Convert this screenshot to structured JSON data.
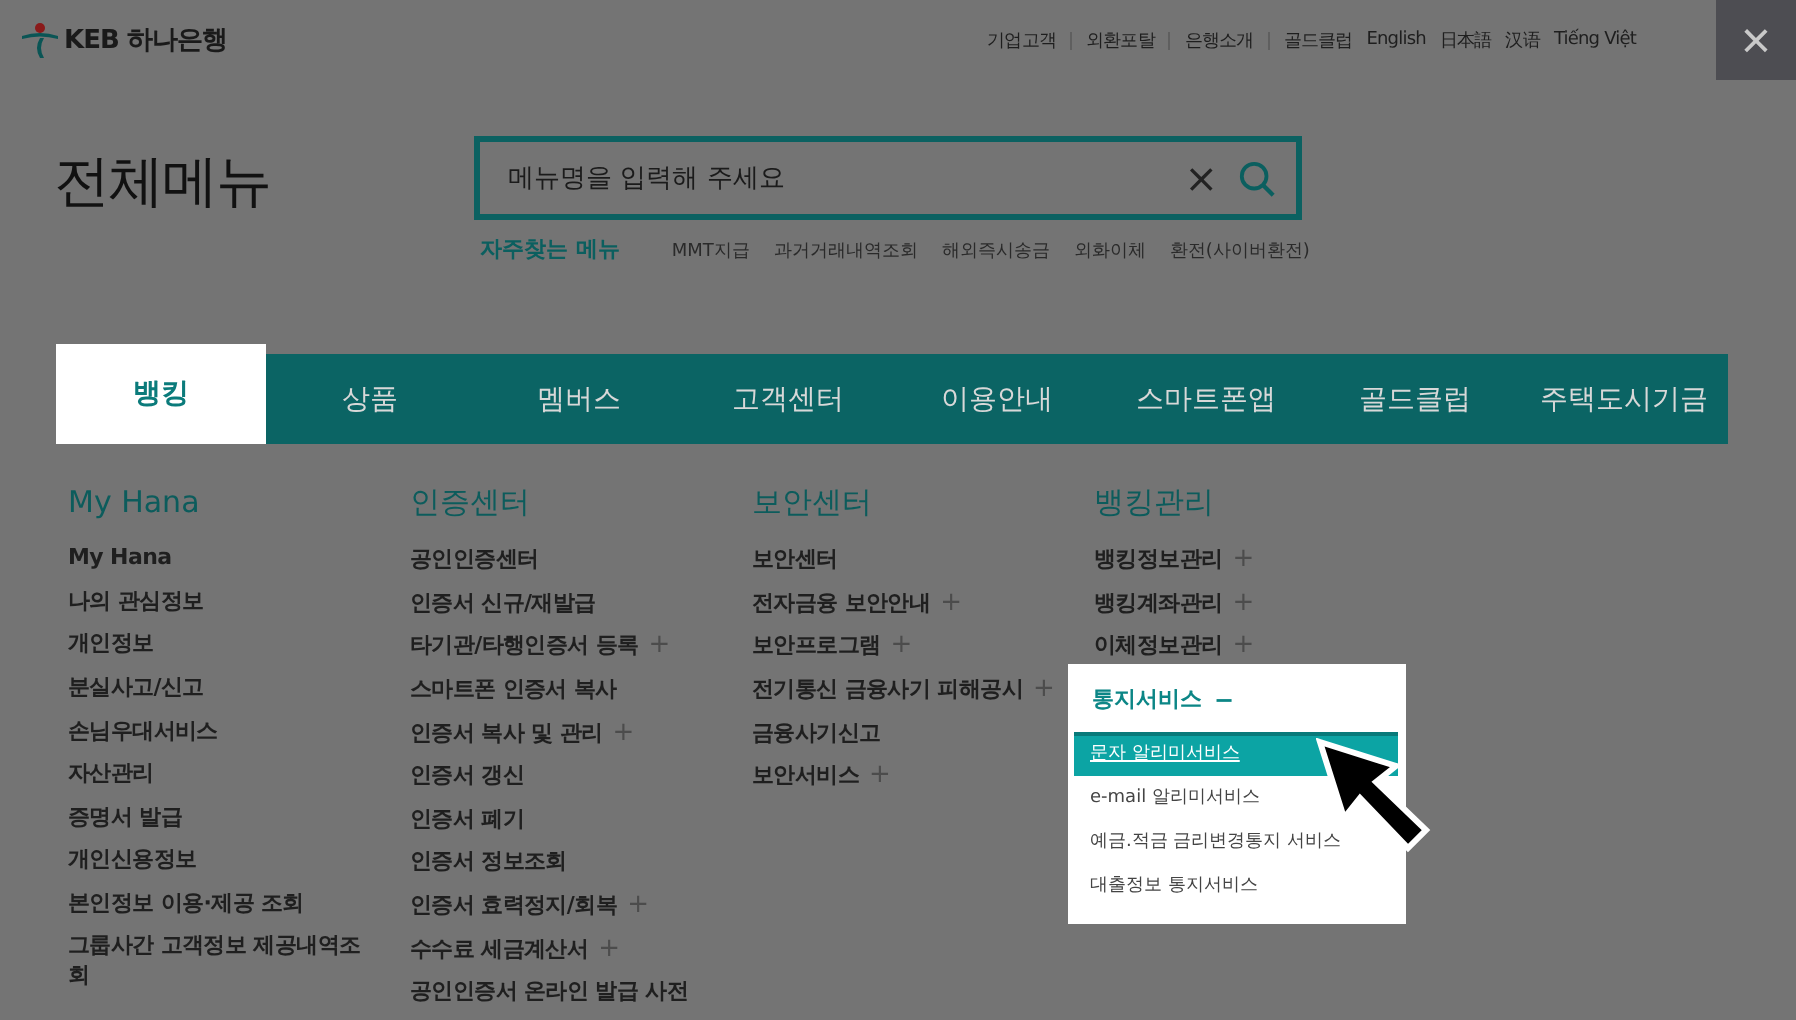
{
  "logo": {
    "text": "KEB 하나은행"
  },
  "top_links": [
    {
      "label": "기업고객",
      "divider": true
    },
    {
      "label": "외환포탈",
      "divider": true
    },
    {
      "label": "은행소개",
      "divider": true
    },
    {
      "label": "골드클럽",
      "divider": false
    },
    {
      "label": "English",
      "divider": false
    },
    {
      "label": "日本語",
      "divider": false
    },
    {
      "label": "汉语",
      "divider": false
    },
    {
      "label": "Tiếng Việt",
      "divider": false
    }
  ],
  "close": {
    "label": "×"
  },
  "page_title": "전체메뉴",
  "search": {
    "placeholder": "메뉴명을 입력해 주세요",
    "clear": "×"
  },
  "frequent": {
    "label": "자주찾는 메뉴",
    "links": [
      "MMT지급",
      "과거거래내역조회",
      "해외즉시송금",
      "외화이체",
      "환전(사이버환전)"
    ]
  },
  "tabs": [
    {
      "label": "뱅킹",
      "selected": true
    },
    {
      "label": "상품",
      "selected": false
    },
    {
      "label": "멤버스",
      "selected": false
    },
    {
      "label": "고객센터",
      "selected": false
    },
    {
      "label": "이용안내",
      "selected": false
    },
    {
      "label": "스마트폰앱",
      "selected": false
    },
    {
      "label": "골드클럽",
      "selected": false
    },
    {
      "label": "주택도시기금",
      "selected": false
    }
  ],
  "columns": [
    {
      "heading": "My Hana",
      "items": [
        {
          "label": "My Hana"
        },
        {
          "label": "나의 관심정보"
        },
        {
          "label": "개인정보"
        },
        {
          "label": "분실사고/신고"
        },
        {
          "label": "손님우대서비스"
        },
        {
          "label": "자산관리"
        },
        {
          "label": "증명서 발급"
        },
        {
          "label": "개인신용정보"
        },
        {
          "label": "본인정보 이용·제공 조회"
        },
        {
          "label": "그룹사간 고객정보 제공내역조회"
        }
      ]
    },
    {
      "heading": "인증센터",
      "items": [
        {
          "label": "공인인증센터"
        },
        {
          "label": "인증서 신규/재발급"
        },
        {
          "label": "타기관/타행인증서 등록",
          "toggle": "+"
        },
        {
          "label": "스마트폰 인증서 복사"
        },
        {
          "label": "인증서 복사 및 관리",
          "toggle": "+"
        },
        {
          "label": "인증서 갱신"
        },
        {
          "label": "인증서 폐기"
        },
        {
          "label": "인증서 정보조회"
        },
        {
          "label": "인증서 효력정지/회복",
          "toggle": "+"
        },
        {
          "label": "수수료 세금계산서",
          "toggle": "+"
        },
        {
          "label": "공인인증서 온라인 발급 사전"
        }
      ]
    },
    {
      "heading": "보안센터",
      "items": [
        {
          "label": "보안센터"
        },
        {
          "label": "전자금융 보안안내",
          "toggle": "+"
        },
        {
          "label": "보안프로그램",
          "toggle": "+"
        },
        {
          "label": "전기통신 금융사기 피해공시",
          "toggle": "+"
        },
        {
          "label": "금융사기신고"
        },
        {
          "label": "보안서비스",
          "toggle": "+"
        }
      ]
    },
    {
      "heading": "뱅킹관리",
      "items": [
        {
          "label": "뱅킹정보관리",
          "toggle": "+"
        },
        {
          "label": "뱅킹계좌관리",
          "toggle": "+"
        },
        {
          "label": "이체정보관리",
          "toggle": "+"
        }
      ]
    }
  ],
  "popup": {
    "heading": "통지서비스",
    "toggle": "−",
    "items": [
      {
        "label": "문자 알리미서비스",
        "selected": true
      },
      {
        "label": "e-mail 알리미서비스",
        "selected": false
      },
      {
        "label": "예금.적금 금리변경통지 서비스",
        "selected": false
      },
      {
        "label": "대출정보 통지서비스",
        "selected": false
      }
    ]
  }
}
